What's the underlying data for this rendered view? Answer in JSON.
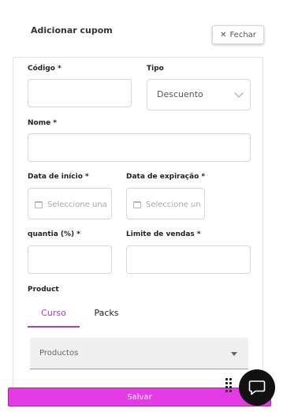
{
  "modal": {
    "title": "Adicionar cupom",
    "close_label": "Fechar"
  },
  "form": {
    "codigo": {
      "label": "Código *",
      "value": ""
    },
    "tipo": {
      "label": "Tipo",
      "value": "Descuento"
    },
    "nome": {
      "label": "Nome *",
      "value": ""
    },
    "data_inicio": {
      "label": "Data de início *",
      "placeholder": "Seleccione una fecha"
    },
    "data_expiracao": {
      "label": "Data de expiração *",
      "placeholder": "Seleccione una fecha"
    },
    "quantia": {
      "label": "quantia (%) *",
      "value": ""
    },
    "limite": {
      "label": "Limite de vendas *",
      "value": ""
    },
    "product": {
      "label": "Product",
      "tabs": [
        {
          "label": "Curso",
          "active": true
        },
        {
          "label": "Packs",
          "active": false
        }
      ],
      "products_select": {
        "label": "Productos"
      }
    }
  },
  "footer": {
    "save_label": "Salvar"
  },
  "colors": {
    "accent": "#b03ac0",
    "save_button": "#e53be6",
    "chat_fab": "#111111"
  },
  "icons": {
    "close": "close-icon",
    "calendar": "calendar-icon",
    "chat": "chat-icon",
    "drag": "drag-handle-icon"
  }
}
